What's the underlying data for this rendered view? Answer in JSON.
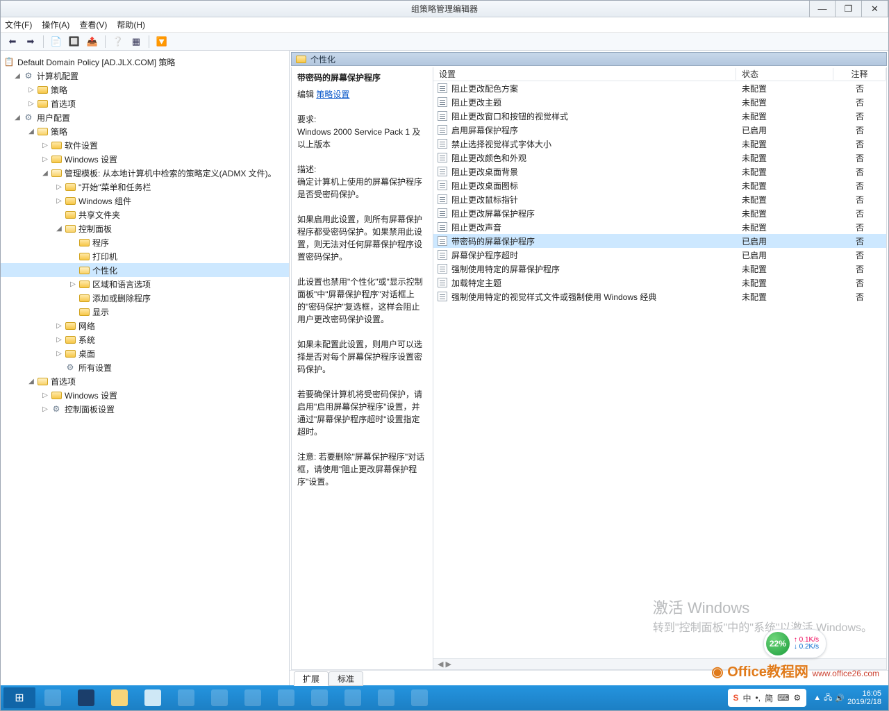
{
  "window": {
    "title": "组策略管理编辑器"
  },
  "title_controls": {
    "min": "—",
    "max": "❐",
    "close": "✕"
  },
  "menus": {
    "file": "文件(F)",
    "action": "操作(A)",
    "view": "查看(V)",
    "help": "帮助(H)"
  },
  "tree": {
    "root": "Default Domain Policy [AD.JLX.COM] 策略",
    "computer_config": "计算机配置",
    "cc_policy": "策略",
    "cc_pref": "首选项",
    "user_config": "用户配置",
    "uc_policy": "策略",
    "software": "软件设置",
    "windows_settings": "Windows 设置",
    "admin_templates": "管理模板: 从本地计算机中检索的策略定义(ADMX 文件)。",
    "start_taskbar": "\"开始\"菜单和任务栏",
    "win_components": "Windows 组件",
    "shared_folders": "共享文件夹",
    "control_panel": "控制面板",
    "programs": "程序",
    "printers": "打印机",
    "personalization": "个性化",
    "region_lang": "区域和语言选项",
    "add_remove": "添加或删除程序",
    "display": "显示",
    "network": "网络",
    "system": "系统",
    "desktop": "桌面",
    "all_settings": "所有设置",
    "uc_pref": "首选项",
    "pref_win_settings": "Windows 设置",
    "pref_cp_settings": "控制面板设置"
  },
  "category": {
    "title": "个性化"
  },
  "detail": {
    "title": "带密码的屏幕保护程序",
    "edit_prefix": "编辑",
    "edit_link": "策略设置",
    "req_label": "要求:",
    "requirement": "Windows 2000 Service Pack 1 及以上版本",
    "desc_label": "描述:",
    "d1": "确定计算机上使用的屏幕保护程序是否受密码保护。",
    "d2": "如果启用此设置，则所有屏幕保护程序都受密码保护。如果禁用此设置，则无法对任何屏幕保护程序设置密码保护。",
    "d3": "此设置也禁用\"个性化\"或\"显示控制面板\"中\"屏幕保护程序\"对话框上的\"密码保护\"复选框，这样会阻止用户更改密码保护设置。",
    "d4": "如果未配置此设置，则用户可以选择是否对每个屏幕保护程序设置密码保护。",
    "d5": "若要确保计算机将受密码保护，请启用\"启用屏幕保护程序\"设置，并通过\"屏幕保护程序超时\"设置指定超时。",
    "d6": "注意: 若要删除\"屏幕保护程序\"对话框，请使用\"阻止更改屏幕保护程序\"设置。"
  },
  "columns": {
    "name": "设置",
    "state": "状态",
    "note": "注释"
  },
  "settings": [
    {
      "name": "阻止更改配色方案",
      "state": "未配置",
      "note": "否"
    },
    {
      "name": "阻止更改主题",
      "state": "未配置",
      "note": "否"
    },
    {
      "name": "阻止更改窗口和按钮的视觉样式",
      "state": "未配置",
      "note": "否"
    },
    {
      "name": "启用屏幕保护程序",
      "state": "已启用",
      "note": "否"
    },
    {
      "name": "禁止选择视觉样式字体大小",
      "state": "未配置",
      "note": "否"
    },
    {
      "name": "阻止更改颜色和外观",
      "state": "未配置",
      "note": "否"
    },
    {
      "name": "阻止更改桌面背景",
      "state": "未配置",
      "note": "否"
    },
    {
      "name": "阻止更改桌面图标",
      "state": "未配置",
      "note": "否"
    },
    {
      "name": "阻止更改鼠标指针",
      "state": "未配置",
      "note": "否"
    },
    {
      "name": "阻止更改屏幕保护程序",
      "state": "未配置",
      "note": "否"
    },
    {
      "name": "阻止更改声音",
      "state": "未配置",
      "note": "否"
    },
    {
      "name": "带密码的屏幕保护程序",
      "state": "已启用",
      "note": "否",
      "selected": true
    },
    {
      "name": "屏幕保护程序超时",
      "state": "已启用",
      "note": "否"
    },
    {
      "name": "强制使用特定的屏幕保护程序",
      "state": "未配置",
      "note": "否"
    },
    {
      "name": "加载特定主题",
      "state": "未配置",
      "note": "否"
    },
    {
      "name": "强制使用特定的视觉样式文件或强制使用 Windows 经典",
      "state": "未配置",
      "note": "否"
    }
  ],
  "tabs": {
    "extended": "扩展",
    "standard": "标准"
  },
  "watermark": {
    "l1": "激活 Windows",
    "l2": "转到\"控制面板\"中的\"系统\"以激活 Windows。"
  },
  "widget": {
    "pct": "22%",
    "up": "0.1K/s",
    "dn": "0.2K/s"
  },
  "ime": {
    "b1": "S",
    "b2": "中",
    "b3": "•,",
    "b4": "简"
  },
  "brand": {
    "name": "Office教程网",
    "url": "www.office26.com"
  },
  "clock": {
    "time": "16:05",
    "date": "2019/2/18"
  }
}
